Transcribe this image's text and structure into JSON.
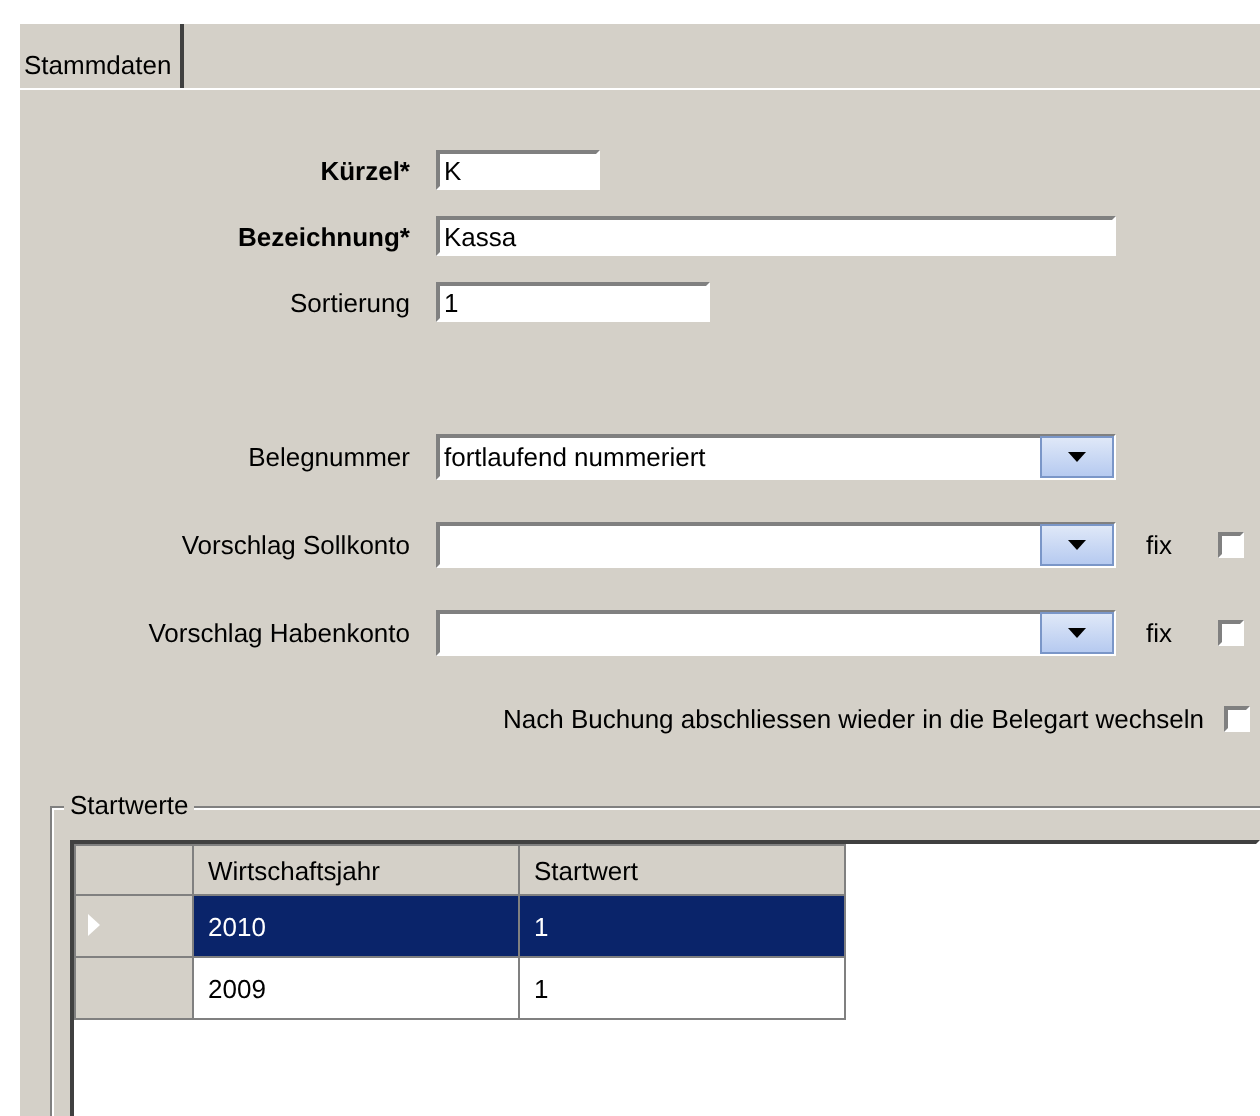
{
  "tabs": [
    {
      "label": "Stammdaten",
      "selected": true
    }
  ],
  "fields": [
    {
      "label": "Kürzel*",
      "required": true,
      "value": "K"
    },
    {
      "label": "Bezeichnung*",
      "required": true,
      "value": "Kassa"
    },
    {
      "label": "Sortierung",
      "required": false,
      "value": "1"
    }
  ],
  "combos": [
    {
      "label": "Belegnummer",
      "value": "fortlaufend nummeriert"
    },
    {
      "label": "Vorschlag Sollkonto",
      "fix": {
        "label": "fix",
        "checked": false
      }
    },
    {
      "label": "Vorschlag Habenkonto",
      "fix": {
        "label": "fix",
        "checked": false
      }
    }
  ],
  "option": {
    "label": "Nach Buchung abschliessen wieder in die Belegart wechseln",
    "checked": false
  },
  "startwerte": {
    "title": "Startwerte",
    "columns": [
      "Wirtschaftsjahr",
      "Startwert"
    ],
    "rows": [
      {
        "selected": true,
        "cells": [
          "2010",
          "1"
        ]
      },
      {
        "selected": false,
        "cells": [
          "2009",
          "1"
        ]
      }
    ]
  }
}
